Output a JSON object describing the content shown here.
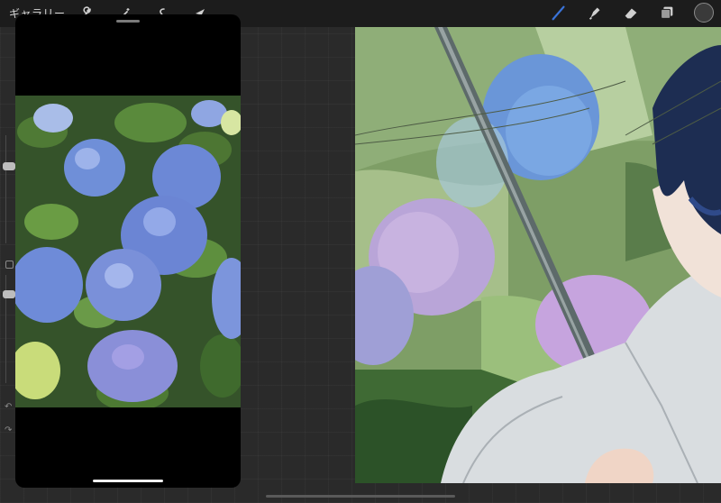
{
  "toolbar": {
    "gallery_label": "ギャラリー",
    "left_tools": [
      "wrench-icon",
      "magic-wand-icon",
      "selection-icon",
      "transform-arrow-icon"
    ],
    "right_tools": [
      "brush-icon",
      "smudge-icon",
      "eraser-icon",
      "layers-icon"
    ],
    "active_tool": "brush-icon",
    "brush_color": "#3a73d8",
    "current_color": "#3a3a3a"
  },
  "reference_window": {
    "label": "",
    "content": "hydrangea-reference-photo"
  },
  "canvas": {
    "content": "hydrangea-umbrella-painting"
  }
}
